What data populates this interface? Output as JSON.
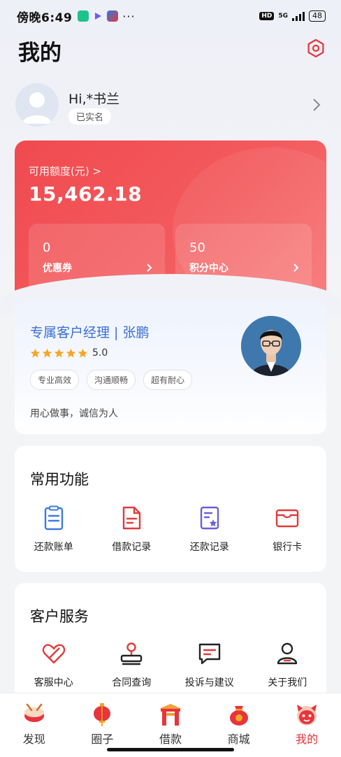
{
  "status_bar": {
    "time": "傍晚6:49",
    "network": "5G",
    "hd": "HD",
    "battery": "48"
  },
  "header": {
    "title": "我的"
  },
  "profile": {
    "greeting": "Hi,*书兰",
    "verified_badge": "已实名"
  },
  "credit_card": {
    "label": "可用额度(元) >",
    "amount": "15,462.18",
    "coupons": {
      "value": "0",
      "label": "优惠券"
    },
    "points": {
      "value": "50",
      "label": "积分中心"
    }
  },
  "manager": {
    "title": "专属客户经理 | 张鹏",
    "rating": "5.0",
    "stars": 5,
    "tags": [
      "专业高效",
      "沟通顺畅",
      "超有耐心"
    ],
    "motto": "用心做事，诚信为人"
  },
  "common_functions": {
    "title": "常用功能",
    "items": [
      {
        "label": "还款账单",
        "icon": "bill-icon"
      },
      {
        "label": "借款记录",
        "icon": "document-icon"
      },
      {
        "label": "还款记录",
        "icon": "record-icon"
      },
      {
        "label": "银行卡",
        "icon": "card-icon"
      }
    ]
  },
  "customer_service": {
    "title": "客户服务",
    "items": [
      {
        "label": "客服中心",
        "icon": "heart-icon"
      },
      {
        "label": "合同查询",
        "icon": "stamp-icon"
      },
      {
        "label": "投诉与建议",
        "icon": "message-icon"
      },
      {
        "label": "关于我们",
        "icon": "user-icon"
      }
    ]
  },
  "tabbar": {
    "items": [
      {
        "label": "发现",
        "active": false
      },
      {
        "label": "圈子",
        "active": false
      },
      {
        "label": "借款",
        "active": false
      },
      {
        "label": "商城",
        "active": false
      },
      {
        "label": "我的",
        "active": true
      }
    ]
  },
  "colors": {
    "brand_red": "#f04a4f",
    "manager_blue": "#3b6fd6",
    "active_tab": "#e8343b",
    "star_orange": "#f5a623"
  }
}
